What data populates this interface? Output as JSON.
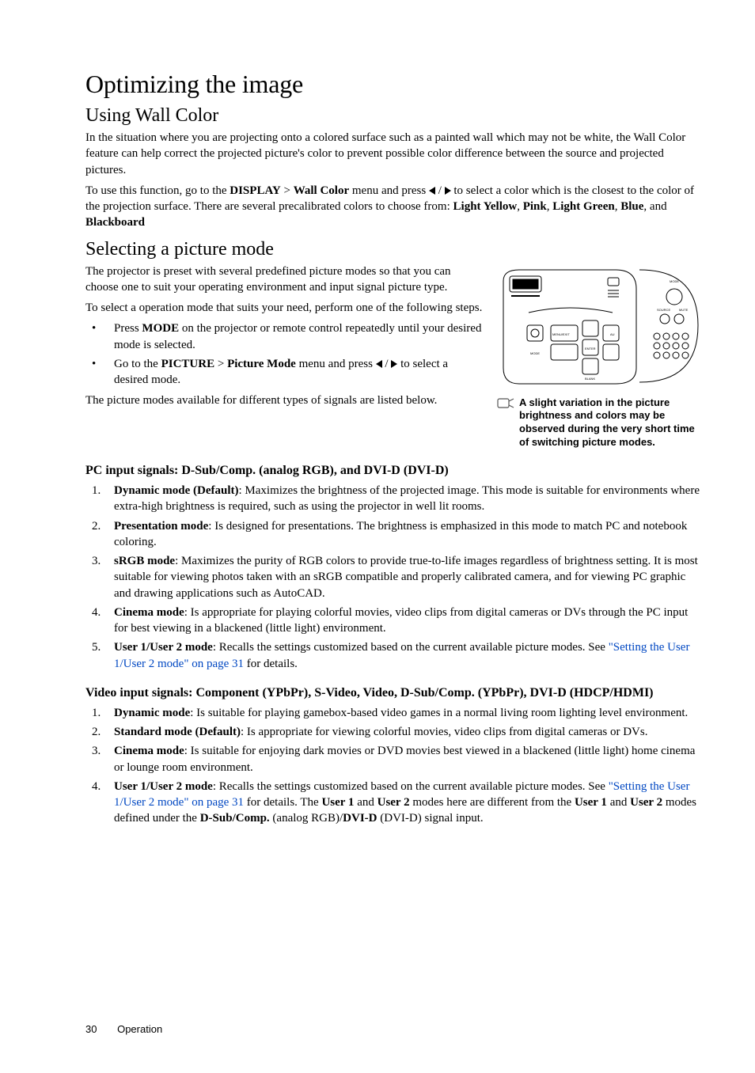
{
  "title": "Optimizing the image",
  "s1": {
    "heading": "Using Wall Color",
    "p1": "In the situation where you are projecting onto a colored surface such as a painted wall which may not be white, the Wall Color feature can help correct the projected picture's color to prevent possible color difference between the source and projected pictures.",
    "p2a": "To use this function, go to the ",
    "p2b": "DISPLAY",
    "p2c": " > ",
    "p2d": "Wall Color",
    "p2e": " menu and press ",
    "p2f": " to select a color which is the closest to the color of the projection surface. There are several precalibrated colors to choose from: ",
    "c1": "Light Yellow",
    "c2": "Pink",
    "c3": "Light Green",
    "c4": "Blue",
    "c5": "Blackboard"
  },
  "s2": {
    "heading": "Selecting a picture mode",
    "p1": "The projector is preset with several predefined picture modes so that you can choose one to suit your operating environment and input signal picture type.",
    "p2": "To select a operation mode that suits your need, perform one of the following steps.",
    "b1a": "Press ",
    "b1b": "MODE",
    "b1c": " on the projector or remote control repeatedly until your desired mode is selected.",
    "b2a": "Go to the ",
    "b2b": "PICTURE",
    "b2c": " > ",
    "b2d": "Picture Mode",
    "b2e": " menu and press ",
    "b2f": " to select a desired mode.",
    "p3": "The picture modes available for different types of signals are listed below.",
    "note": "A slight variation in the picture brightness and colors may be observed during the very short time of switching picture modes."
  },
  "s3": {
    "heading": "PC input signals: D-Sub/Comp. (analog RGB), and DVI-D (DVI-D)",
    "items": [
      {
        "n": "1.",
        "b": "Dynamic mode (Default)",
        "t": ": Maximizes the brightness of the projected image. This mode is suitable for environments where extra-high brightness is required, such as using the projector in well lit rooms."
      },
      {
        "n": "2.",
        "b": "Presentation mode",
        "t": ": Is designed for presentations. The brightness is emphasized in this mode to match PC and notebook coloring."
      },
      {
        "n": "3.",
        "b": "sRGB mode",
        "t": ": Maximizes the purity of RGB colors to provide true-to-life images regardless of brightness setting. It is most suitable for viewing photos taken with an sRGB compatible and properly calibrated camera, and for viewing PC graphic and drawing applications such as AutoCAD."
      },
      {
        "n": "4.",
        "b": "Cinema mode",
        "t": ": Is appropriate for playing colorful movies, video clips from digital cameras or DVs through the PC input for best viewing in a blackened (little light) environment."
      },
      {
        "n": "5.",
        "b": "User 1/User 2 mode",
        "t": ": Recalls the settings customized based on the current available picture modes. See ",
        "link": "\"Setting the User 1/User 2 mode\" on page 31",
        "t2": " for details."
      }
    ]
  },
  "s4": {
    "heading": "Video input signals: Component (YPbPr), S-Video, Video, D-Sub/Comp. (YPbPr), DVI-D (HDCP/HDMI)",
    "items": [
      {
        "n": "1.",
        "b": "Dynamic mode",
        "t": ": Is suitable for playing gamebox-based video games in a normal living room lighting level environment."
      },
      {
        "n": "2.",
        "b": "Standard mode (Default)",
        "t": ": Is appropriate for viewing colorful movies, video clips from digital cameras or DVs."
      },
      {
        "n": "3.",
        "b": "Cinema mode",
        "t": ": Is suitable for enjoying dark movies or DVD movies best viewed in a blackened (little light) home cinema or lounge room environment."
      },
      {
        "n": "4.",
        "b": "User 1/User 2 mode",
        "t": ": Recalls the settings customized based on the current available picture modes. See ",
        "link": "\"Setting the User 1/User 2 mode\" on page 31",
        "t2": " for details. The ",
        "u1": "User 1",
        "t3": " and ",
        "u2": "User 2",
        "t4": " modes here are different from the ",
        "u3": "User 1",
        "t5": " and ",
        "u4": "User 2",
        "t6": " modes defined under the ",
        "d1": "D-Sub/Comp.",
        "t7": " (analog RGB)/",
        "d2": "DVI-D",
        "t8": " (DVI-D) signal input."
      }
    ]
  },
  "footer": {
    "page": "30",
    "section": "Operation"
  }
}
